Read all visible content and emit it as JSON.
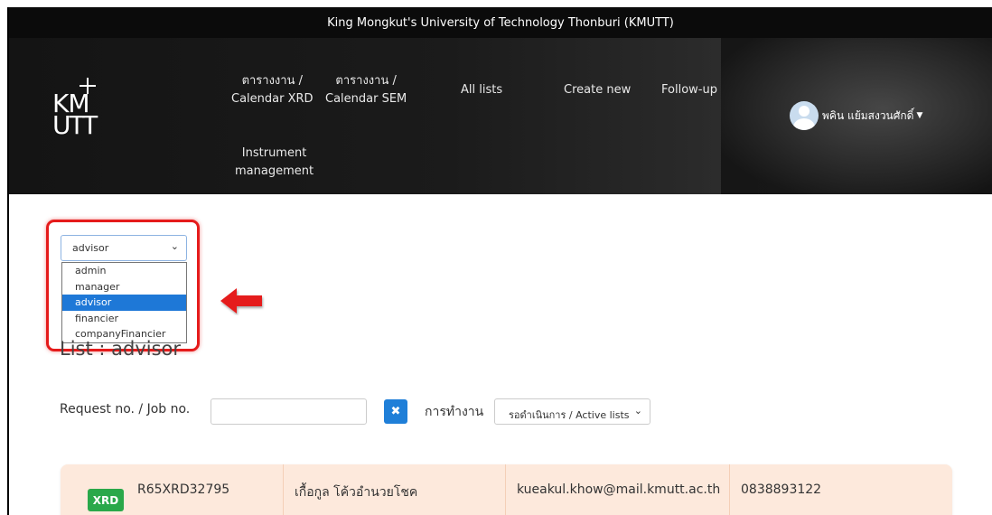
{
  "topbar": {
    "title": "King Mongkut's University of Technology Thonburi (KMUTT)"
  },
  "logo": {
    "line1": "KM",
    "line2": "UTT"
  },
  "nav": {
    "calendar_xrd": [
      "ตารางงาน /",
      "Calendar XRD"
    ],
    "calendar_sem": [
      "ตารางงาน /",
      "Calendar SEM"
    ],
    "all_lists": "All lists",
    "create_new": "Create new",
    "follow_up": "Follow-up",
    "instrument": [
      "Instrument",
      "management"
    ]
  },
  "user": {
    "name": "พคิน แย้มสงวนศักดิ์"
  },
  "role_select": {
    "value": "advisor",
    "options": [
      "admin",
      "manager",
      "advisor",
      "financier",
      "companyFinancier"
    ],
    "selected_index": 2
  },
  "list_title": "List : advisor",
  "filters": {
    "request_label": "Request no. / Job no.",
    "request_value": "",
    "work_label": "การทำงาน",
    "work_value": "รอดำเนินการ / Active lists"
  },
  "records": [
    {
      "badge": "XRD",
      "request_no": "R65XRD32795",
      "name": "เกื้อกูล โค้วอำนวยโชค",
      "email": "kueakul.khow@mail.kmutt.ac.th",
      "phone": "0838893122"
    }
  ],
  "colors": {
    "highlight": "#e51b1b",
    "selected_option": "#1e78d7",
    "badge": "#2aa84a",
    "card_bg": "#fde9dc"
  },
  "icons": {
    "user": "user-avatar-icon",
    "clear": "times-icon",
    "pointer": "left-arrow-icon"
  }
}
